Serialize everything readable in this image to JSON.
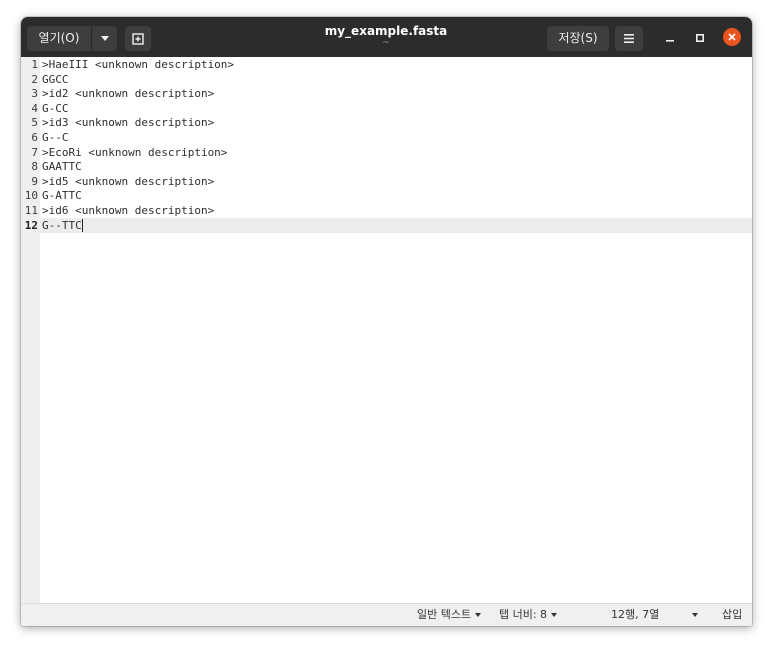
{
  "header": {
    "open_label": "열기(O)",
    "title": "my_example.fasta",
    "subtitle": "~",
    "save_label": "저장(S)",
    "icons": {
      "open_dropdown": "chevron-down-icon",
      "new_document": "new-document-icon",
      "menu": "hamburger-menu-icon",
      "minimize": "minimize-icon",
      "maximize": "maximize-icon",
      "close": "close-icon"
    },
    "colors": {
      "titlebar": "#2c2c2c",
      "close": "#e95420"
    }
  },
  "editor": {
    "current_line": "12",
    "lines": [
      {
        "num": "1",
        "text": ">HaeIII <unknown description>"
      },
      {
        "num": "2",
        "text": "GGCC"
      },
      {
        "num": "3",
        "text": ">id2 <unknown description>"
      },
      {
        "num": "4",
        "text": "G-CC"
      },
      {
        "num": "5",
        "text": ">id3 <unknown description>"
      },
      {
        "num": "6",
        "text": "G--C"
      },
      {
        "num": "7",
        "text": ">EcoRi <unknown description>"
      },
      {
        "num": "8",
        "text": "GAATTC"
      },
      {
        "num": "9",
        "text": ">id5 <unknown description>"
      },
      {
        "num": "10",
        "text": "G-ATTC"
      },
      {
        "num": "11",
        "text": ">id6 <unknown description>"
      },
      {
        "num": "12",
        "text": "G--TTC"
      }
    ]
  },
  "statusbar": {
    "language": "일반 텍스트",
    "tab_width": "탭 너비: 8",
    "position": "12행, 7열",
    "mode": "삽입"
  }
}
